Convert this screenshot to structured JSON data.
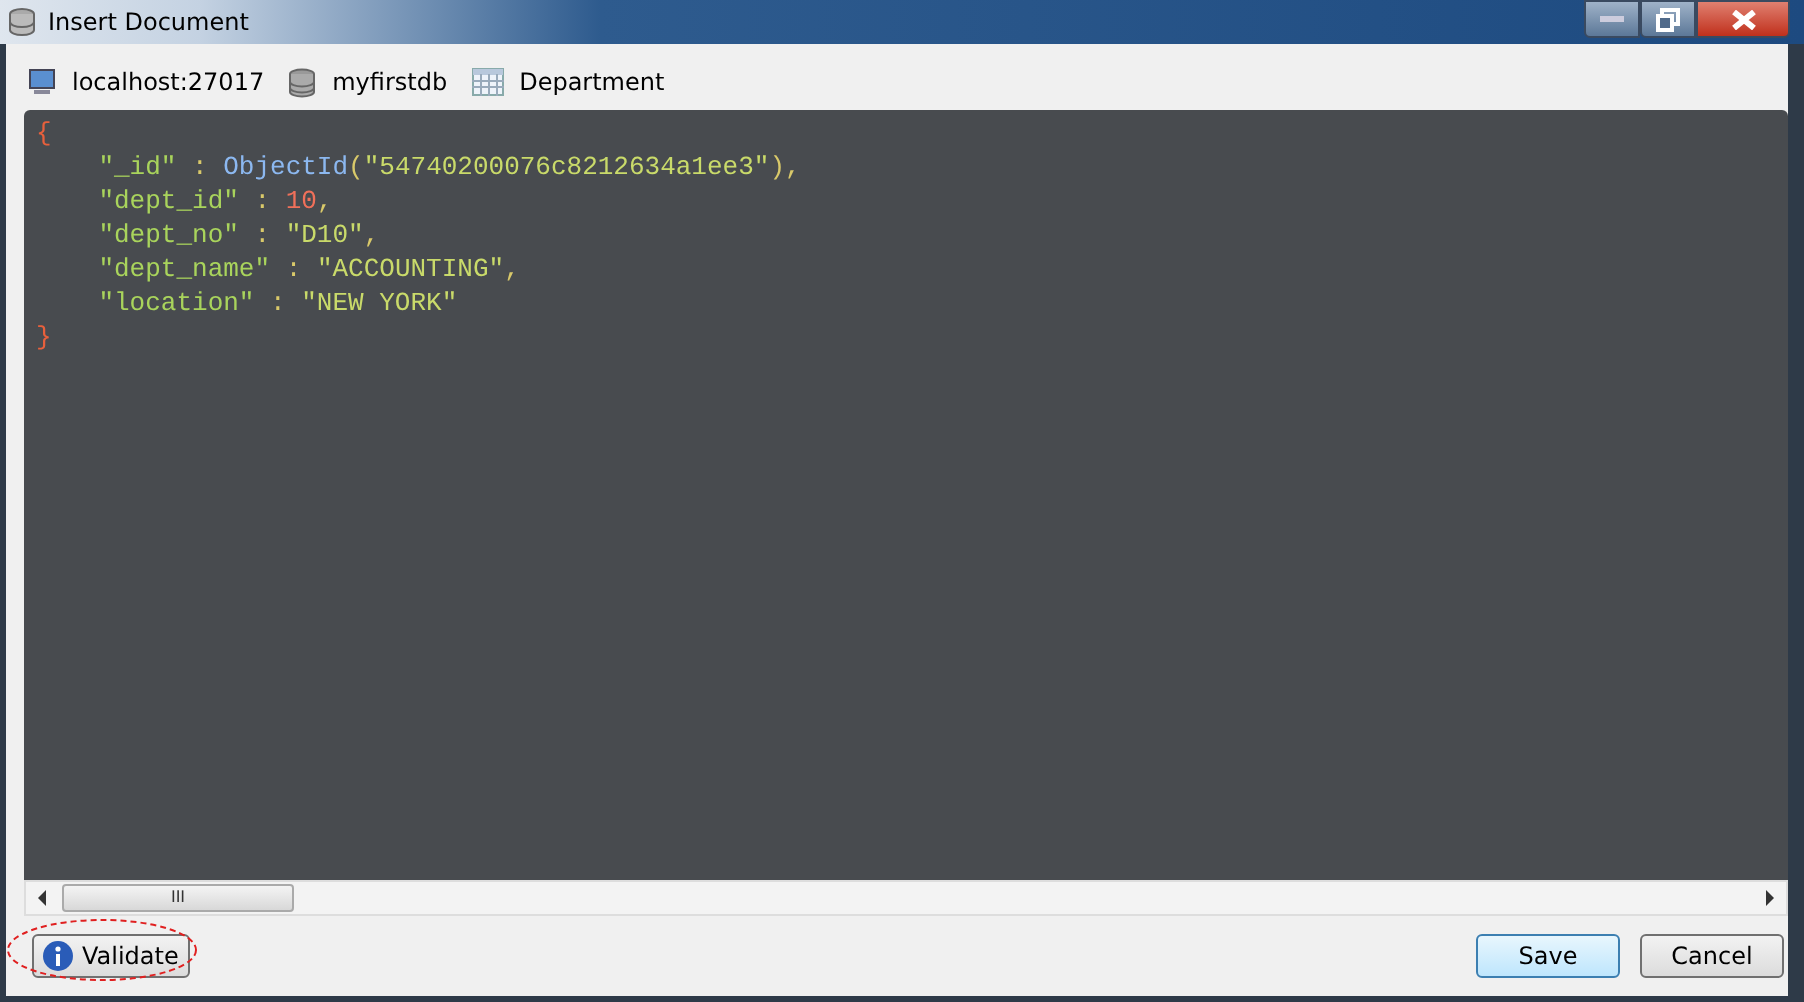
{
  "window": {
    "title": "Insert Document"
  },
  "breadcrumb": [
    {
      "kind": "server",
      "label": "localhost:27017"
    },
    {
      "kind": "database",
      "label": "myfirstdb"
    },
    {
      "kind": "collection",
      "label": "Department"
    }
  ],
  "editor": {
    "lines": [
      [
        {
          "kind": "brace",
          "text": "{"
        }
      ],
      [
        {
          "kind": "key",
          "text": "    \"_id\""
        },
        {
          "kind": "punct",
          "text": " : "
        },
        {
          "kind": "func",
          "text": "ObjectId"
        },
        {
          "kind": "punct",
          "text": "("
        },
        {
          "kind": "string",
          "text": "\"54740200076c8212634a1ee3\""
        },
        {
          "kind": "punct",
          "text": "),"
        }
      ],
      [
        {
          "kind": "key",
          "text": "    \"dept_id\""
        },
        {
          "kind": "punct",
          "text": " : "
        },
        {
          "kind": "number",
          "text": "10"
        },
        {
          "kind": "punct",
          "text": ","
        }
      ],
      [
        {
          "kind": "key",
          "text": "    \"dept_no\""
        },
        {
          "kind": "punct",
          "text": " : "
        },
        {
          "kind": "string",
          "text": "\"D10\""
        },
        {
          "kind": "punct",
          "text": ","
        }
      ],
      [
        {
          "kind": "key",
          "text": "    \"dept_name\""
        },
        {
          "kind": "punct",
          "text": " : "
        },
        {
          "kind": "string",
          "text": "\"ACCOUNTING\""
        },
        {
          "kind": "punct",
          "text": ","
        }
      ],
      [
        {
          "kind": "key",
          "text": "    \"location\""
        },
        {
          "kind": "punct",
          "text": " : "
        },
        {
          "kind": "string",
          "text": "\"NEW YORK\""
        }
      ],
      [
        {
          "kind": "brace",
          "text": "}"
        }
      ]
    ],
    "scrollbar": {
      "thumb_label": "III"
    }
  },
  "buttons": {
    "validate": "Validate",
    "save": "Save",
    "cancel": "Cancel"
  }
}
